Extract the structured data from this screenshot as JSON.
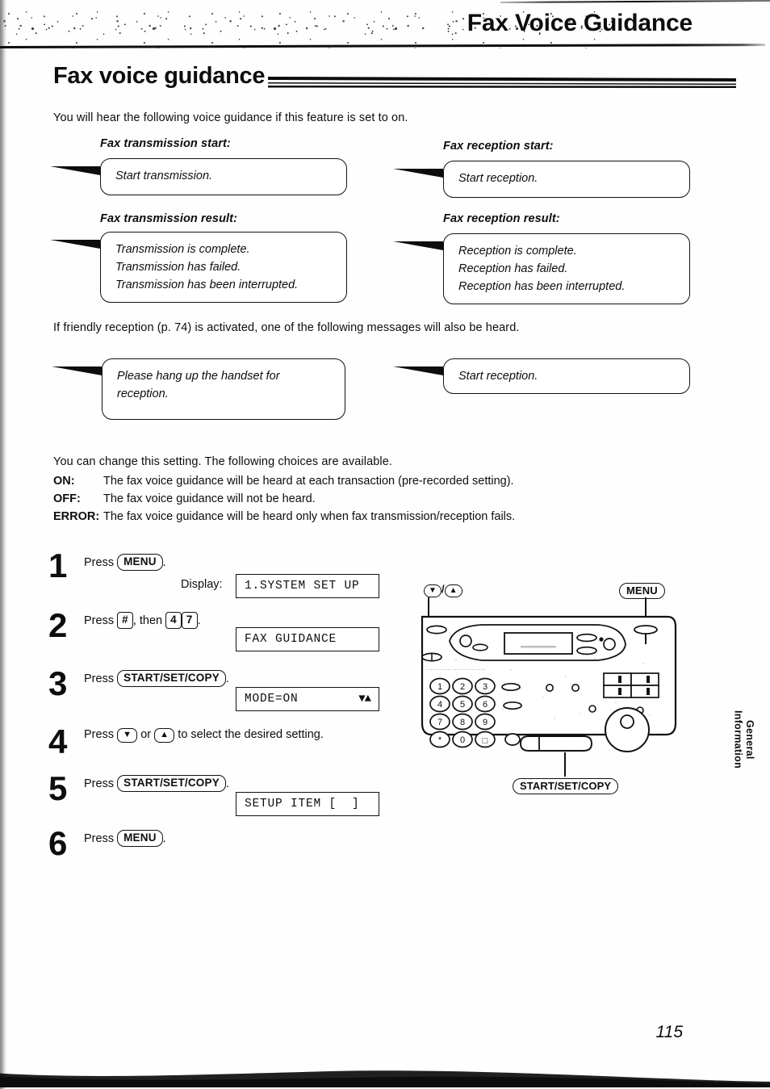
{
  "header": {
    "running_head": "Fax Voice Guidance",
    "page_number": "115",
    "side_tab_line1": "General",
    "side_tab_line2": "Information"
  },
  "title": "Fax voice guidance",
  "intro": "You will hear the following voice guidance if this feature is set to on.",
  "callouts": [
    {
      "label": "Fax transmission start:",
      "lines": [
        "Start transmission."
      ]
    },
    {
      "label": "Fax reception start:",
      "lines": [
        "Start reception."
      ]
    },
    {
      "label": "Fax transmission result:",
      "lines": [
        "Transmission is complete.",
        "Transmission has failed.",
        "Transmission has been interrupted."
      ]
    },
    {
      "label": "Fax reception result:",
      "lines": [
        "Reception is complete.",
        "Reception has failed.",
        "Reception has been interrupted."
      ]
    }
  ],
  "friendly": {
    "text": "If friendly reception (p. 74) is activated, one of the following messages will also be heard.",
    "bubble_left": [
      "Please hang up the handset for",
      "reception."
    ],
    "bubble_right": [
      "Start reception."
    ]
  },
  "settings": {
    "lead": "You can change this setting. The following choices are available.",
    "rows": [
      {
        "term": "ON:",
        "desc": "The fax voice guidance will be heard at each transaction (pre-recorded setting)."
      },
      {
        "term": "OFF:",
        "desc": "The fax voice guidance will not be heard."
      },
      {
        "term": "ERROR:",
        "desc": "The fax voice guidance will be heard only when fax transmission/reception fails."
      }
    ]
  },
  "steps": [
    {
      "num": "1",
      "press_word": "Press",
      "key": "MENU",
      "trailing": ".",
      "display_label": "Display:",
      "lcd": "1.SYSTEM SET UP"
    },
    {
      "num": "2",
      "press_word": "Press",
      "key_hash": "#",
      "then_word": ", then",
      "key_a": "4",
      "key_b": "7",
      "trailing": ".",
      "lcd": "FAX GUIDANCE"
    },
    {
      "num": "3",
      "press_word": "Press",
      "key": "START/SET/COPY",
      "trailing": ".",
      "lcd": "MODE=ON",
      "lcd_arrows": "▼▲"
    },
    {
      "num": "4",
      "press_word": "Press",
      "key_down": "▼",
      "or_word": "or",
      "key_up": "▲",
      "tail_text": "to select the desired setting."
    },
    {
      "num": "5",
      "press_word": "Press",
      "key": "START/SET/COPY",
      "trailing": ".",
      "lcd": "SETUP ITEM [  ]"
    },
    {
      "num": "6",
      "press_word": "Press",
      "key": "MENU",
      "trailing": "."
    }
  ],
  "device": {
    "label_arrows": "▼",
    "label_arrows_sep": "/",
    "label_arrows_up": "▲",
    "label_menu": "MENU",
    "label_start": "START/SET/COPY",
    "keypad": [
      "1",
      "2",
      "3",
      "4",
      "5",
      "6",
      "7",
      "8",
      "9",
      "*",
      "0",
      "#"
    ]
  },
  "colors": {
    "ink": "#0d0d0d",
    "paper": "#fefefe"
  }
}
